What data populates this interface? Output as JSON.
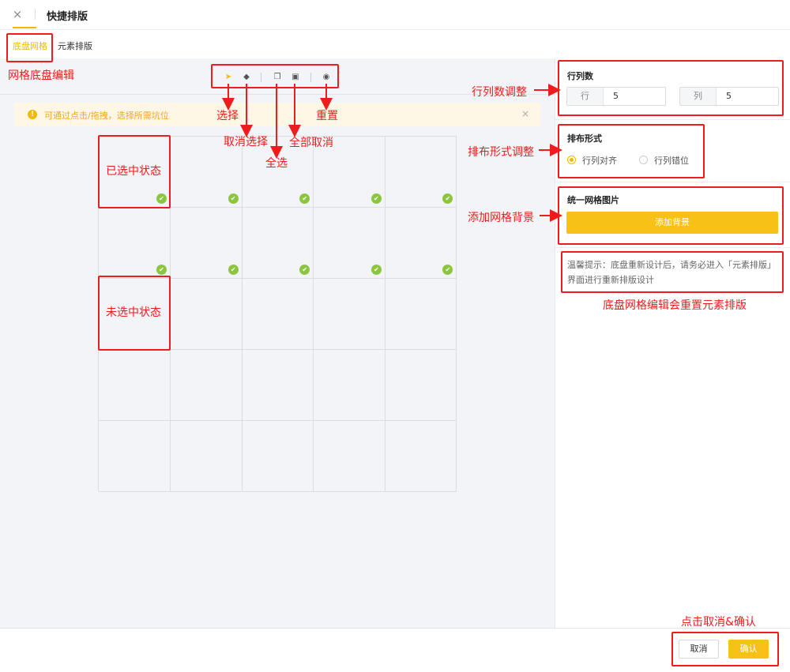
{
  "header": {
    "close_symbol": "×",
    "title": "快捷排版"
  },
  "tabs": [
    {
      "label": "底盘网格",
      "active": true
    },
    {
      "label": "元素排版",
      "active": false
    }
  ],
  "toolbar": {
    "icons": [
      "cursor-icon",
      "eraser-icon",
      "select-all-icon",
      "trash-icon",
      "reset-icon"
    ]
  },
  "notice": {
    "text": "可通过点击/拖拽，选择所需坑位",
    "close_symbol": "×"
  },
  "grid": {
    "rows": 5,
    "cols": 5,
    "selected_rows": [
      0,
      1
    ],
    "check_symbol": "✔"
  },
  "right_panel": {
    "rowcol": {
      "title": "行列数",
      "row_label": "行",
      "row_value": "5",
      "col_label": "列",
      "col_value": "5"
    },
    "layout": {
      "title": "排布形式",
      "options": [
        {
          "label": "行列对齐",
          "selected": true
        },
        {
          "label": "行列错位",
          "selected": false
        }
      ]
    },
    "background": {
      "title": "统一网格图片",
      "button_label": "添加背景"
    },
    "tip": "温馨提示：底盘重新设计后，请务必进入「元素排版」界面进行重新排版设计"
  },
  "footer": {
    "cancel_label": "取消",
    "ok_label": "确认"
  },
  "annotations": {
    "grid_edit": "网格底盘编辑",
    "select": "选择",
    "deselect": "取消选择",
    "select_all": "全选",
    "clear_all": "全部取消",
    "reset": "重置",
    "selected_state": "已选中状态",
    "unselected_state": "未选中状态",
    "rowcol_adjust": "行列数调整",
    "layout_adjust": "排布形式调整",
    "add_bg": "添加网格背景",
    "reset_warning": "底盘网格编辑会重置元素排版",
    "cancel_confirm": "点击取消&确认"
  },
  "colors": {
    "accent": "#f7c115",
    "check": "#8cc63f",
    "annotation": "#ee1c1c"
  }
}
